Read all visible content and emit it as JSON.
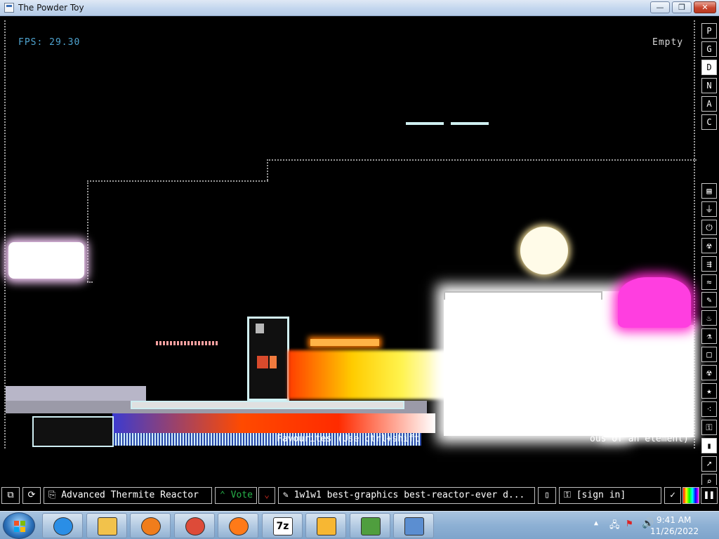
{
  "window": {
    "title": "The Powder Toy",
    "minimize": "—",
    "maximize": "❐",
    "close": "✕"
  },
  "hud": {
    "fps": "FPS: 29.30",
    "hover_element": "Empty"
  },
  "canvas_overlay_text": "Favourites (Use ctrl+shift",
  "canvas_overlay_text_right": "ous of an element)",
  "side_menu": {
    "top": [
      "P",
      "G",
      "D",
      "N",
      "A",
      "C"
    ],
    "active_top": "D",
    "categories": [
      "wall-icon",
      "plug-icon",
      "power-icon",
      "explosive-icon",
      "gas-icon",
      "liquid-icon",
      "pen-icon",
      "fire-icon",
      "flask-icon",
      "square-icon",
      "radiation-icon",
      "star-icon",
      "dots-icon",
      "lock-icon",
      "bookmark-icon",
      "cursor-icon",
      "search-icon"
    ],
    "active_category": "bookmark-icon"
  },
  "bottom_bar": {
    "save_name": "Advanced Thermite Reactor",
    "vote_label": "Vote",
    "tags": "1w1w1 best-graphics best-reactor-ever d...",
    "sign_in": "[sign in]"
  },
  "taskbar": {
    "apps": [
      "internet-explorer-icon",
      "file-explorer-icon",
      "media-player-icon",
      "chrome-icon",
      "firefox-icon",
      "7zip-icon",
      "photo-icon",
      "network-icon",
      "control-panel-icon"
    ],
    "zip_label": "7z",
    "clock_time": "9:41 AM",
    "clock_date": "11/26/2022"
  },
  "colors": {
    "fps_text": "#4fa4d0",
    "accent_yellow": "#ffd400",
    "accent_pink": "#ff2bd0",
    "accent_orange": "#ff6a00",
    "vote_green": "#27b24a",
    "vote_red": "#c0271f"
  }
}
